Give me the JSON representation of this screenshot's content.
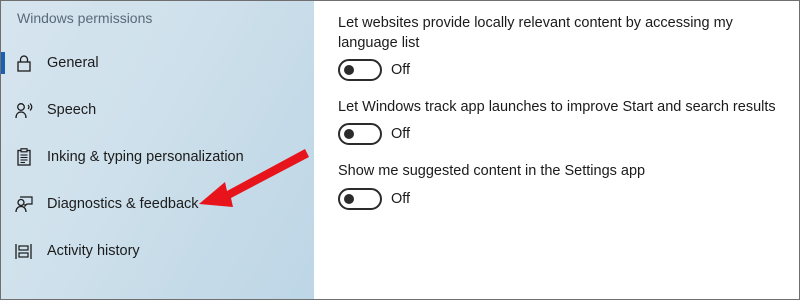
{
  "sidebar": {
    "header": "Windows permissions",
    "items": [
      {
        "label": "General",
        "icon": "lock-icon"
      },
      {
        "label": "Speech",
        "icon": "speech-icon"
      },
      {
        "label": "Inking & typing personalization",
        "icon": "clipboard-icon"
      },
      {
        "label": "Diagnostics & feedback",
        "icon": "feedback-icon"
      },
      {
        "label": "Activity history",
        "icon": "activity-history-icon"
      }
    ],
    "selected_item": "General"
  },
  "main": {
    "settings": [
      {
        "text": "Let websites provide locally relevant content by accessing my language list",
        "state": "Off"
      },
      {
        "text": "Let Windows track app launches to improve Start and search results",
        "state": "Off"
      },
      {
        "text": "Show me suggested content in the Settings app",
        "state": "Off"
      }
    ]
  },
  "colors": {
    "accent": "#1a5fb4",
    "annotation_arrow": "#e8141b"
  }
}
